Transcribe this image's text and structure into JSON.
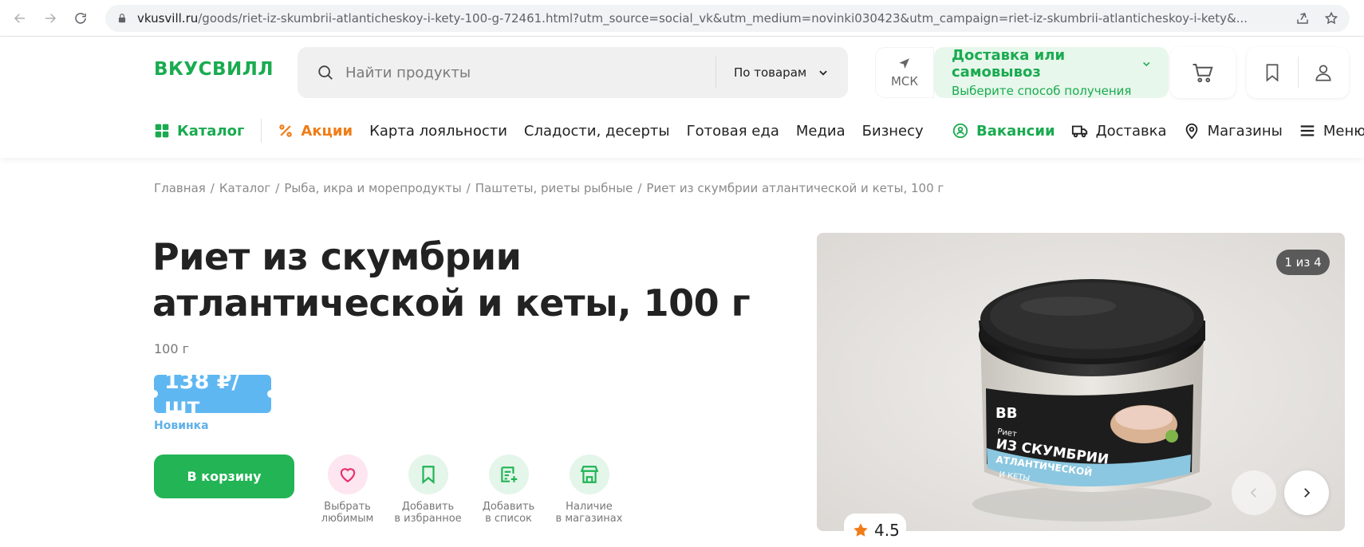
{
  "browser": {
    "url_host": "vkusvill.ru",
    "url_rest": "/goods/riet-iz-skumbrii-atlanticheskoy-i-kety-100-g-72461.html?utm_source=social_vk&utm_medium=novinki030423&utm_campaign=riet-iz-skumbrii-atlanticheskoy-i-kety&..."
  },
  "header": {
    "logo": "ВКУСВИЛЛ",
    "search_placeholder": "Найти продукты",
    "search_scope": "По товарам",
    "city": "МСК",
    "delivery_title": "Доставка или самовывоз",
    "delivery_subtitle": "Выберите способ получения"
  },
  "menu": {
    "catalog": "Каталог",
    "promo": "Акции",
    "items": [
      "Карта лояльности",
      "Сладости, десерты",
      "Готовая еда",
      "Медиа",
      "Бизнесу"
    ],
    "jobs": "Вакансии",
    "delivery": "Доставка",
    "stores": "Магазины",
    "menu": "Меню"
  },
  "breadcrumb": [
    "Главная",
    "Каталог",
    "Рыба, икра и морепродукты",
    "Паштеты, риеты рыбные",
    "Риет из скумбрии атлантической и кеты, 100 г"
  ],
  "product": {
    "title": "Риет из скумбрии атлантической и кеты, 100 г",
    "weight": "100 г",
    "price": "138 ₽/шт",
    "badge": "Новинка",
    "add_to_cart": "В корзину",
    "actions": [
      {
        "label": "Выбрать\nлюбимым"
      },
      {
        "label": "Добавить\nв избранное"
      },
      {
        "label": "Добавить\nв список"
      },
      {
        "label": "Наличие\nв магазинах"
      }
    ],
    "gallery_counter": "1 из 4",
    "rating": "4.5",
    "jar_label": {
      "brand": "ВВ",
      "small": "Риет",
      "line1": "ИЗ СКУМБРИИ",
      "line2": "АТЛАНТИЧЕСКОЙ",
      "line3": "И КЕТЫ"
    }
  },
  "colors": {
    "brand_green": "#1aab50",
    "button_green": "#22b455",
    "promo_orange": "#f07d17",
    "price_blue": "#5fb7f2"
  }
}
